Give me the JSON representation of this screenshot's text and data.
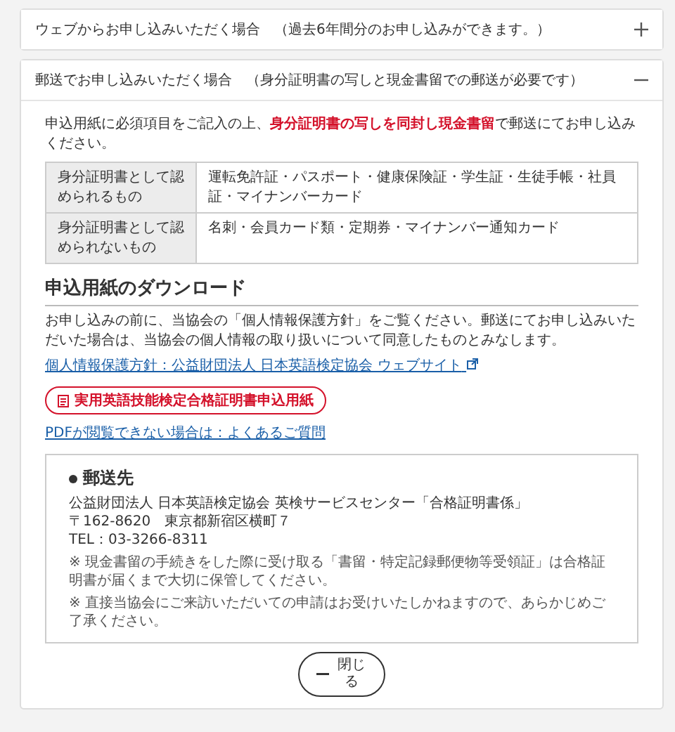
{
  "accordions": [
    {
      "title": "ウェブからお申し込みいただく場合　（過去6年間分のお申し込みができます。）",
      "expanded": false
    },
    {
      "title": "郵送でお申し込みいただく場合　（身分証明書の写しと現金書留での郵送が必要です）",
      "expanded": true,
      "content": {
        "intro": "申込用紙に必須項目をご記入の上、**身分証明書の写しを同封し現金書留**で郵送にてお申し込みください。",
        "table": [
          {
            "header": "身分証明書として認められるもの",
            "value": "運転免許証・パスポート・健康保険証・学生証・生徒手帳・社員証・マイナンバーカード"
          },
          {
            "header": "身分証明書として認められないもの",
            "value": "名刺・会員カード類・定期券・マイナンバー通知カード"
          }
        ],
        "heading": "申込用紙のダウンロード",
        "paragraph": "お申し込みの前に、当協会の「個人情報保護方針」をご覧ください。郵送にてお申し込みいただいた場合は、当協会の個人情報の取り扱いについて同意したものとみなします。",
        "policy_link": "個人情報保護方針：公益財団法人 日本英語検定協会 ウェブサイト",
        "form_button": "実用英語技能検定合格証明書申込用紙",
        "faq_link": "PDFが閲覧できない場合は：よくあるご質問",
        "address": {
          "title": "郵送先",
          "lines": [
            "公益財団法人 日本英語検定協会 英検サービスセンター「合格証明書係」",
            "〒162-8620　東京都新宿区横町７",
            "TEL：03-3266-8311"
          ],
          "notes": [
            "※ 現金書留の手続きをした際に受け取る「書留・特定記録郵便物等受領証」は合格証明書が届くまで大切に保管してください。",
            "※ 直接当協会にご来訪いただいての申請はお受けいたしかねますので、あらかじめご了承ください。"
          ]
        },
        "close_button": "閉じる"
      }
    }
  ]
}
